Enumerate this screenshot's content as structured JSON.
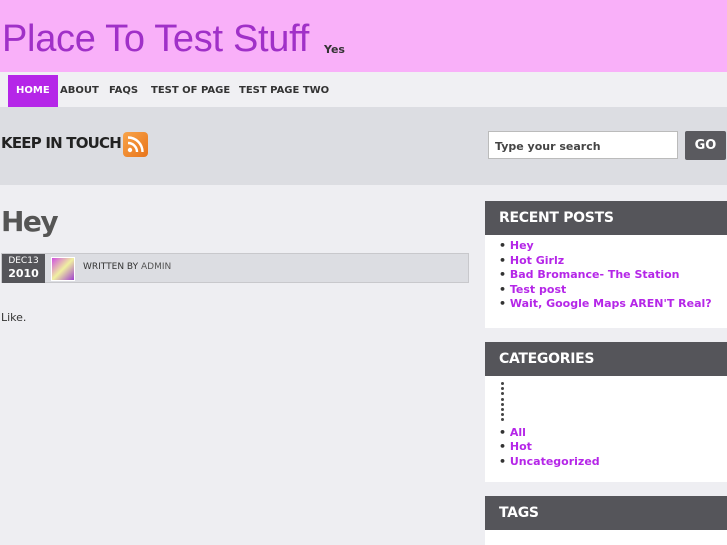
{
  "site": {
    "title": "Place To Test Stuff",
    "description": "Yes"
  },
  "nav": {
    "items": [
      "HOME",
      "ABOUT",
      "FAQS",
      "TEST OF PAGE",
      "TEST PAGE TWO"
    ]
  },
  "bar": {
    "keep_in_touch": "KEEP IN TOUCH",
    "search_placeholder": "Type your search",
    "go_label": "GO"
  },
  "post": {
    "title": "Hey",
    "date_month_day": "DEC13",
    "date_year": "2010",
    "written_by": "WRITTEN BY",
    "author": "ADMIN",
    "body": "Like."
  },
  "sidebar": {
    "recent_posts": {
      "title": "RECENT POSTS",
      "items": [
        "Hey",
        "Hot Girlz",
        "Bad Bromance- The Station",
        "Test post",
        "Wait, Google Maps AREN'T Real?"
      ]
    },
    "categories": {
      "title": "CATEGORIES",
      "items": [
        "All",
        "Hot",
        "Uncategorized"
      ]
    },
    "tags": {
      "title": "TAGS"
    }
  },
  "colors": {
    "header": "#f9b0f9",
    "accent": "#b526e8",
    "widget_head": "#55555a"
  },
  "icons": {
    "feed": "rss-feed-icon"
  }
}
